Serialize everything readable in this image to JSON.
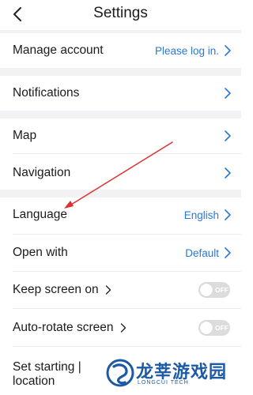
{
  "header": {
    "title": "Settings",
    "back_icon": "chevron-left-icon"
  },
  "account": {
    "label": "Manage account",
    "value": "Please log in."
  },
  "notifications": {
    "label": "Notifications"
  },
  "map": {
    "label": "Map"
  },
  "navigation": {
    "label": "Navigation"
  },
  "language": {
    "label": "Language",
    "value": "English"
  },
  "open_with": {
    "label": "Open with",
    "value": "Default"
  },
  "keep_screen_on": {
    "label": "Keep screen on",
    "toggle_text": "OFF"
  },
  "auto_rotate": {
    "label": "Auto-rotate screen",
    "toggle_text": "OFF"
  },
  "set_starting_location": {
    "label_line1": "Set starting |",
    "label_line2": "location"
  },
  "watermark": {
    "text": "龙莘游戏园",
    "subtext": "LONGCUI TECH"
  },
  "colors": {
    "accent": "#2a78d6",
    "annotation_arrow": "#e0312c",
    "section_gap": "#f2f2f4",
    "toggle_off": "#dcdcdc"
  }
}
